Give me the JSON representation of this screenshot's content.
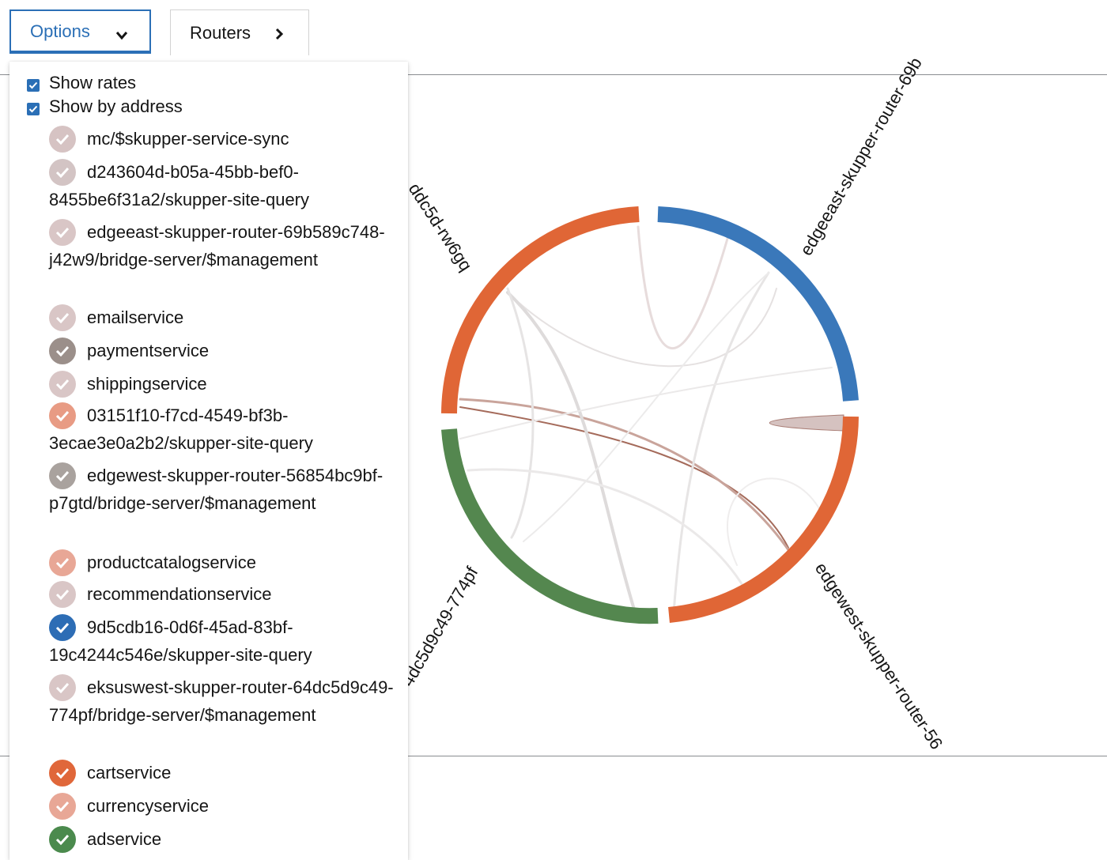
{
  "toolbar": {
    "options_label": "Options",
    "routers_label": "Routers"
  },
  "options_panel": {
    "checks": [
      {
        "label": "Show rates",
        "checked": true
      },
      {
        "label": "Show by address",
        "checked": true
      }
    ],
    "addresses": [
      {
        "label": "mc/$skupper-service-sync",
        "color": "#d6c3c3"
      },
      {
        "label": "d243604d-b05a-45bb-bef0-8455be6f31a2/skupper-site-query",
        "color": "#d3c4c4"
      },
      {
        "label": "edgeeast-skupper-router-69b589c748-j42w9/bridge-server/$management",
        "color": "#d9c6c6"
      },
      {
        "label": "emailservice",
        "color": "#d9c6c6"
      },
      {
        "label": "paymentservice",
        "color": "#9b8f8a"
      },
      {
        "label": "shippingservice",
        "color": "#d9c6c6"
      },
      {
        "label": "03151f10-f7cd-4549-bf3b-3ecae3e0a2b2/skupper-site-query",
        "color": "#e89b84"
      },
      {
        "label": "edgewest-skupper-router-56854bc9bf-p7gtd/bridge-server/$management",
        "color": "#a9a29e"
      },
      {
        "label": "productcatalogservice",
        "color": "#e8a796"
      },
      {
        "label": "recommendationservice",
        "color": "#d9c6c6"
      },
      {
        "label": "9d5cdb16-0d6f-45ad-83bf-19c4244c546e/skupper-site-query",
        "color": "#2d6db5"
      },
      {
        "label": "eksuswest-skupper-router-64dc5d9c49-774pf/bridge-server/$management",
        "color": "#d9c6c6"
      },
      {
        "label": "cartservice",
        "color": "#e0673a"
      },
      {
        "label": "currencyservice",
        "color": "#e8a796"
      },
      {
        "label": "adservice",
        "color": "#4b8a4d"
      }
    ]
  },
  "chart": {
    "router_labels": [
      {
        "text": "edgeeast-skupper-router-69b",
        "color": "#3a78ba"
      },
      {
        "text": "edgewest-skupper-router-56",
        "color": "#e06636"
      },
      {
        "text": "4dc5d9c49-774pf",
        "color": "#54874f"
      },
      {
        "text": "ddc5d-rw6gq",
        "color": "#e06636"
      }
    ]
  }
}
